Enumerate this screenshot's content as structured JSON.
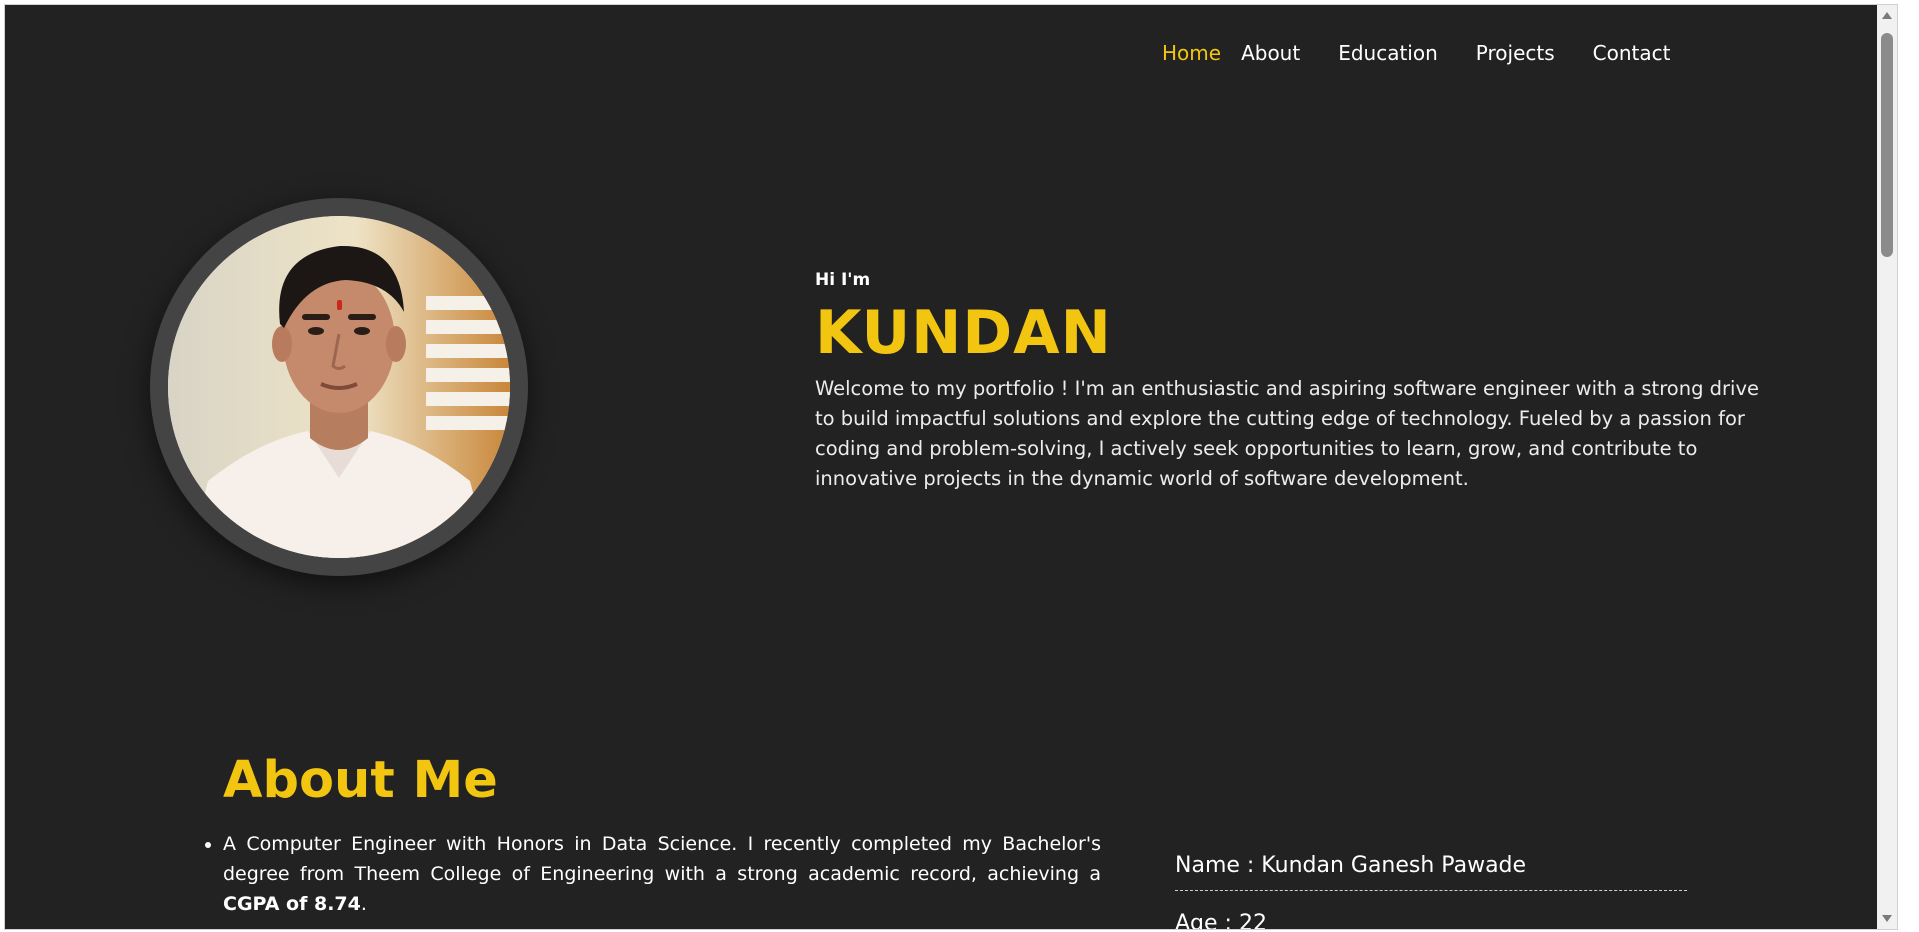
{
  "nav": {
    "items": [
      {
        "label": "Home"
      },
      {
        "label": "About"
      },
      {
        "label": "Education"
      },
      {
        "label": "Projects"
      },
      {
        "label": "Contact"
      }
    ]
  },
  "hero": {
    "greeting": "Hi I'm",
    "name": "KUNDAN",
    "intro": "Welcome to my portfolio ! I'm an enthusiastic and aspiring software engineer with a strong drive to build impactful solutions and explore the cutting edge of technology. Fueled by a passion for coding and problem-solving, I actively seek opportunities to learn, grow, and contribute to innovative projects in the dynamic world of software development."
  },
  "about": {
    "title": "About Me",
    "point1_text": "A Computer Engineer with Honors in Data Science. I recently completed my Bachelor's degree from Theem College of Engineering with a strong academic record, achieving a ",
    "point1_bold": "CGPA of 8.74",
    "point1_end": "."
  },
  "info": {
    "name_row": "Name : Kundan Ganesh Pawade",
    "age_row": "Age : 22"
  },
  "colors": {
    "background": "#222222",
    "accent": "#f2c511",
    "text": "#ffffff"
  }
}
